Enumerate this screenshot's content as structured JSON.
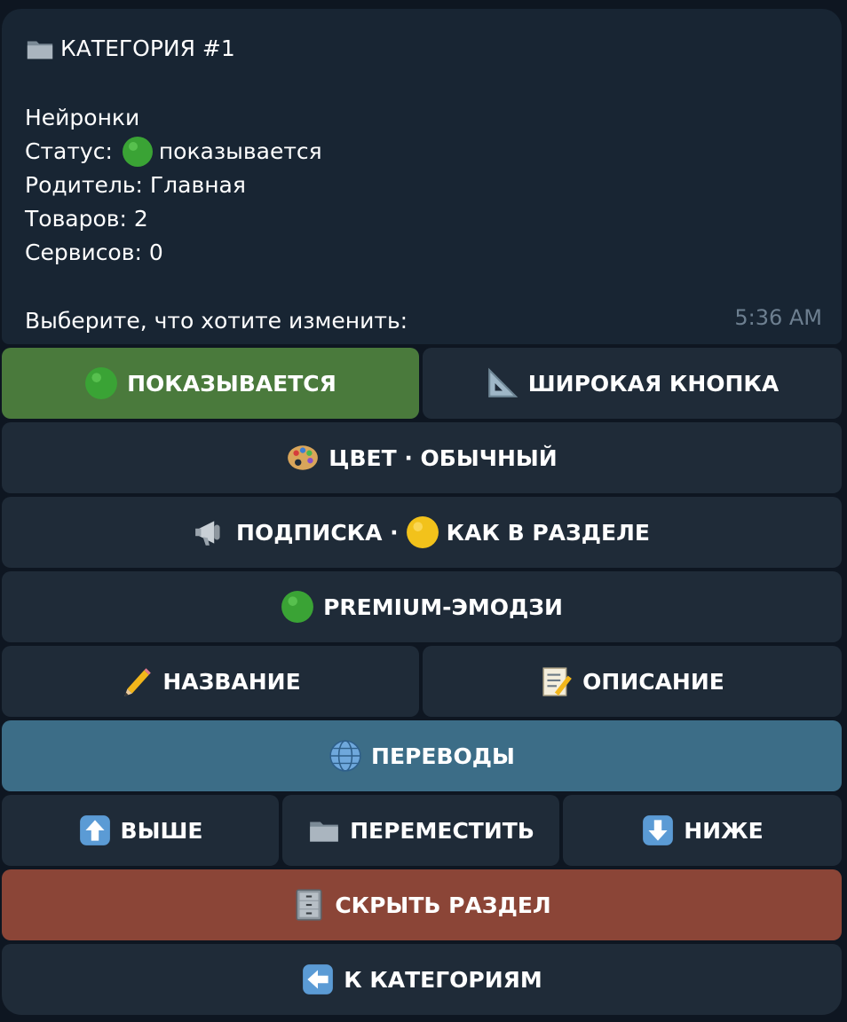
{
  "message": {
    "title": "КАТЕГОРИЯ #1",
    "name": "Нейронки",
    "status_label": "Статус: ",
    "status_value": "показывается",
    "parent": "Родитель: Главная",
    "products": "Товаров: 2",
    "services": "Сервисов: 0",
    "prompt": "Выберите, что хотите изменить:",
    "time": "5:36 AM"
  },
  "buttons": {
    "showing": "ПОКАЗЫВАЕТСЯ",
    "wide": "ШИРОКАЯ КНОПКА",
    "color": "ЦВЕТ · ОБЫЧНЫЙ",
    "subscription": "ПОДПИСКА ·",
    "subscription_suffix": "КАК В РАЗДЕЛЕ",
    "premium": "PREMIUM-ЭМОДЗИ",
    "name": "НАЗВАНИЕ",
    "description": "ОПИСАНИЕ",
    "translations": "ПЕРЕВОДЫ",
    "up": "ВЫШЕ",
    "move": "ПЕРЕМЕСТИТЬ",
    "down": "НИЖЕ",
    "hide": "СКРЫТЬ РАЗДЕЛ",
    "back": "К КАТЕГОРИЯМ"
  },
  "colors": {
    "bubble": "#182533",
    "button": "#1f2b38",
    "green": "#4a7a3c",
    "blue": "#3c6d87",
    "red": "#8b4537"
  },
  "icons": {
    "title": "folder-icon",
    "status": "green-circle-icon",
    "showing": "green-circle-icon",
    "wide": "triangle-ruler-icon",
    "color": "palette-icon",
    "subscription": "megaphone-icon",
    "subscription_state": "yellow-circle-icon",
    "premium": "green-circle-icon",
    "name": "pencil-icon",
    "description": "memo-icon",
    "translations": "globe-icon",
    "up": "arrow-up-icon",
    "move": "folder-icon",
    "down": "arrow-down-icon",
    "hide": "file-cabinet-icon",
    "back": "arrow-left-icon"
  }
}
